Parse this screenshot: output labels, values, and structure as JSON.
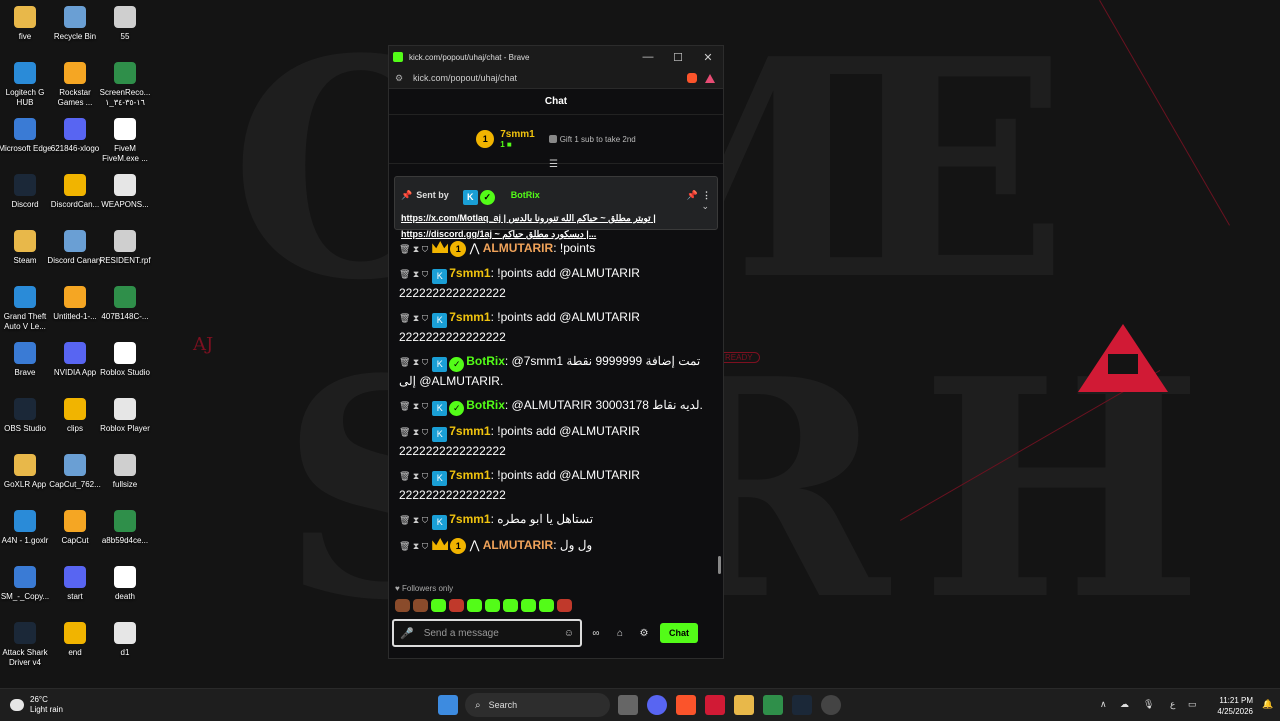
{
  "wallpaper": {
    "aj_text": "AJ",
    "ready_text": "READY"
  },
  "desktop_icons": [
    {
      "label": "five"
    },
    {
      "label": "Recycle Bin"
    },
    {
      "label": "55"
    },
    {
      "label": "Logitech G HUB"
    },
    {
      "label": "Rockstar Games ..."
    },
    {
      "label": "ScreenReco... ١٦-٣٥-٣٤_١"
    },
    {
      "label": "Microsoft Edge"
    },
    {
      "label": "621846-xlogo"
    },
    {
      "label": "FiveM FiveM.exe ..."
    },
    {
      "label": "Discord"
    },
    {
      "label": "DiscordCan..."
    },
    {
      "label": "WEAPONS..."
    },
    {
      "label": "Steam"
    },
    {
      "label": "Discord Canary"
    },
    {
      "label": "RESIDENT.rpf"
    },
    {
      "label": "Grand Theft Auto V Le..."
    },
    {
      "label": "Untitled-1-..."
    },
    {
      "label": "407B148C-..."
    },
    {
      "label": "Brave"
    },
    {
      "label": "NVIDIA App"
    },
    {
      "label": "Roblox Studio"
    },
    {
      "label": "OBS Studio"
    },
    {
      "label": "clips"
    },
    {
      "label": "Roblox Player"
    },
    {
      "label": "GoXLR App"
    },
    {
      "label": "CapCut_762..."
    },
    {
      "label": "fullsize"
    },
    {
      "label": "A4N - 1.goxlr"
    },
    {
      "label": "CapCut"
    },
    {
      "label": "a8b59d4ce..."
    },
    {
      "label": "SM_-_Copy..."
    },
    {
      "label": "start"
    },
    {
      "label": "death"
    },
    {
      "label": "Attack Shark Driver v4"
    },
    {
      "label": "end"
    },
    {
      "label": "d1"
    }
  ],
  "window": {
    "title": "kick.com/popout/uhaj/chat - Brave",
    "url": "kick.com/popout/uhaj/chat",
    "minimize": "—",
    "maximize": "☐",
    "close": "✕"
  },
  "chat": {
    "header": "Chat",
    "leader_rank": "1",
    "leader_name": "7smm1",
    "leader_count": "1",
    "gift_text": "Gift 1 sub to take 2nd",
    "pinned": {
      "sent_by": "Sent by",
      "bot_name": "BotRix",
      "line1": "https://x.com/Motlaq_aj | تويتر مطلق ~ حياكم الله تنورونا بالدس |",
      "line2": "https://discord.gg/1aj ~ ديسكورد مطلق حياكم |..."
    },
    "messages": [
      {
        "name": "ALMUTARIR",
        "color": "#f1a35a",
        "badges": "crown-gold",
        "text": ": !points"
      },
      {
        "name": "7smm1",
        "color": "#f1c40f",
        "badges": "kick",
        "text": ": !points add @ALMUTARIR 2222222222222222"
      },
      {
        "name": "7smm1",
        "color": "#f1c40f",
        "badges": "kick",
        "text": ": !points add @ALMUTARIR 2222222222222222"
      },
      {
        "name": "BotRix",
        "color": "#53fc18",
        "badges": "kick-verified",
        "text": ": @7smm1 تمت إضافة 9999999 نقطة إلى @ALMUTARIR."
      },
      {
        "name": "BotRix",
        "color": "#53fc18",
        "badges": "kick-verified",
        "text": ": @ALMUTARIR لديه نقاط 30003178."
      },
      {
        "name": "7smm1",
        "color": "#f1c40f",
        "badges": "kick",
        "text": ": !points add @ALMUTARIR 2222222222222222"
      },
      {
        "name": "7smm1",
        "color": "#f1c40f",
        "badges": "kick",
        "text": ": !points add @ALMUTARIR 2222222222222222"
      },
      {
        "name": "7smm1",
        "color": "#f1c40f",
        "badges": "kick",
        "text": ": تستاهل يا ابو مطره"
      },
      {
        "name": "ALMUTARIR",
        "color": "#f1a35a",
        "badges": "crown-gold",
        "text": ": ول ول"
      }
    ],
    "followers_only": "Followers only",
    "input_placeholder": "Send a message",
    "send_label": "Chat"
  },
  "taskbar": {
    "temperature": "26°C",
    "weather": "Light rain",
    "search_label": "Search",
    "lang": "ع",
    "time": "11:21 PM",
    "date": "4/25/2026"
  },
  "colors": {
    "kick_green": "#53fc18",
    "gold": "#f1b400"
  }
}
